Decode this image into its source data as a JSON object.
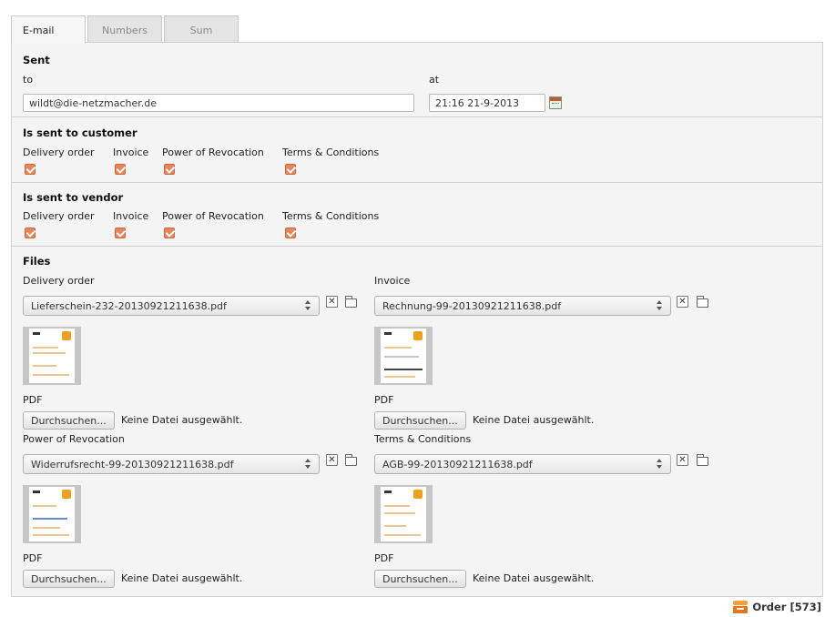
{
  "tabs": [
    {
      "label": "E-mail",
      "active": true
    },
    {
      "label": "Numbers",
      "active": false
    },
    {
      "label": "Sum",
      "active": false
    }
  ],
  "sent": {
    "heading": "Sent",
    "to_label": "to",
    "to_value": "wildt@die-netzmacher.de",
    "at_label": "at",
    "at_value": "21:16 21-9-2013"
  },
  "customer": {
    "heading": "Is sent to customer",
    "items": [
      {
        "label": "Delivery order",
        "checked": true
      },
      {
        "label": "Invoice",
        "checked": true
      },
      {
        "label": "Power of Revocation",
        "checked": true
      },
      {
        "label": "Terms & Conditions",
        "checked": true
      }
    ]
  },
  "vendor": {
    "heading": "Is sent to vendor",
    "items": [
      {
        "label": "Delivery order",
        "checked": true
      },
      {
        "label": "Invoice",
        "checked": true
      },
      {
        "label": "Power of Revocation",
        "checked": true
      },
      {
        "label": "Terms & Conditions",
        "checked": true
      }
    ]
  },
  "files": {
    "heading": "Files",
    "browse_label": "Durchsuchen...",
    "no_file_text": "Keine Datei ausgewählt.",
    "remove_symbol": "✕",
    "items": [
      {
        "label": "Delivery order",
        "file": "Lieferschein-232-20130921211638.pdf",
        "type": "PDF"
      },
      {
        "label": "Invoice",
        "file": "Rechnung-99-20130921211638.pdf",
        "type": "PDF"
      },
      {
        "label": "Power of Revocation",
        "file": "Widerrufsrecht-99-20130921211638.pdf",
        "type": "PDF"
      },
      {
        "label": "Terms & Conditions",
        "file": "AGB-99-20130921211638.pdf",
        "type": "PDF"
      }
    ]
  },
  "footer": {
    "order_label": "Order [573]"
  }
}
